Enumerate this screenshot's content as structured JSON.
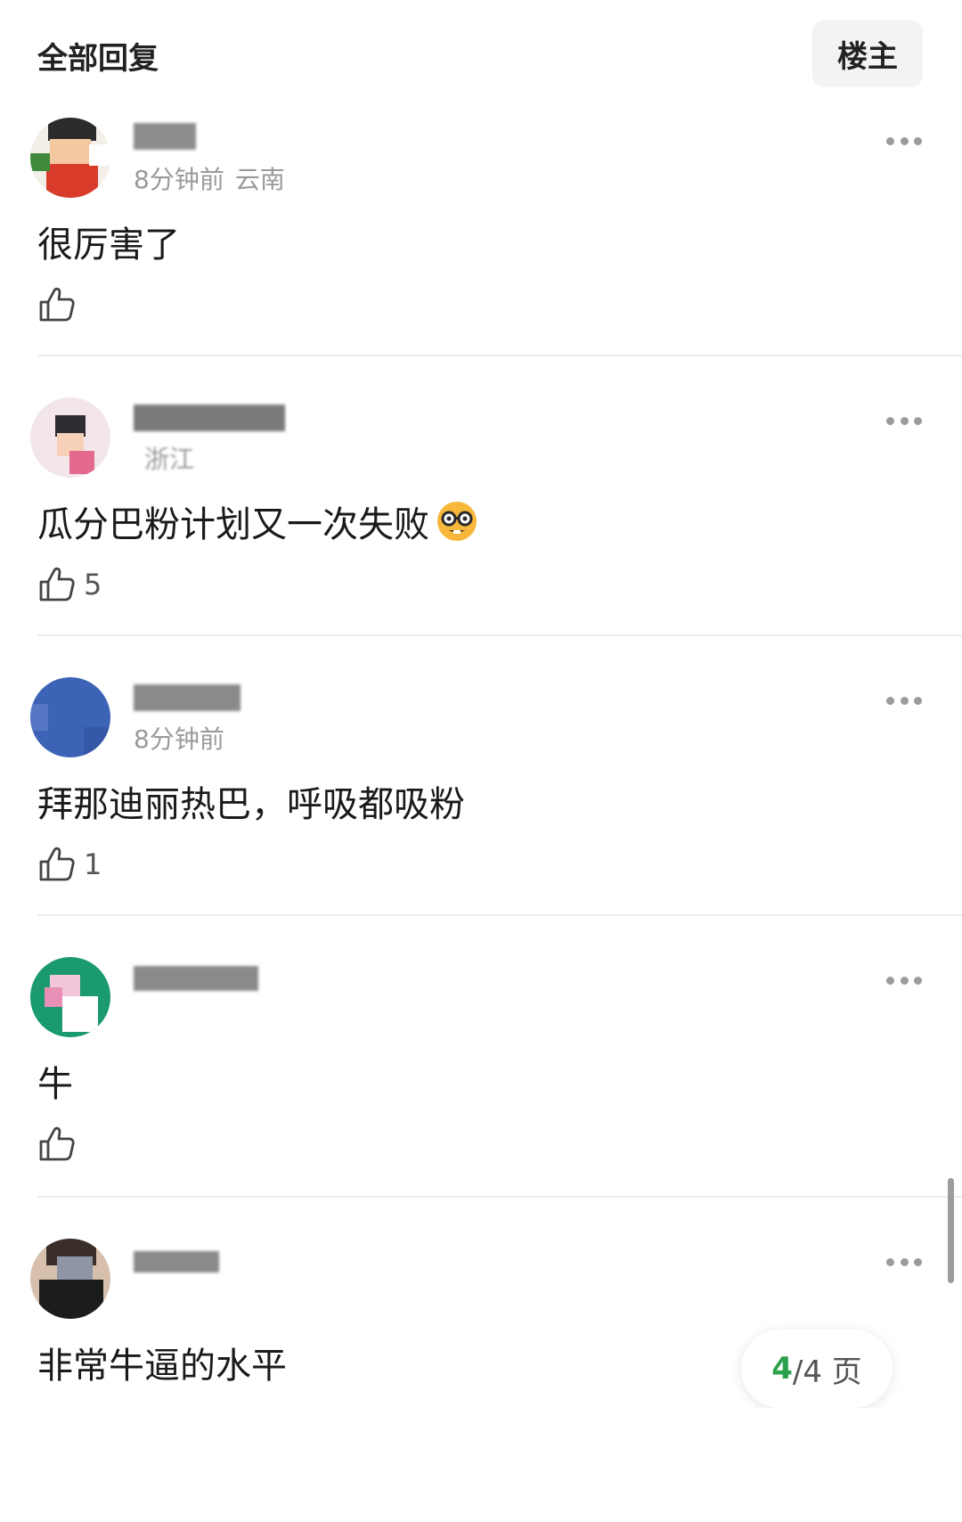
{
  "header": {
    "title": "全部回复",
    "op_button": "楼主"
  },
  "comments": [
    {
      "username": "",
      "time": "8分钟前",
      "location": "云南",
      "text": "很厉害了",
      "likes": "",
      "avatar_colors": [
        "#2b2b2b",
        "#d93b2b",
        "#f4c9a1",
        "#3f8a3a",
        "#ffffff"
      ]
    },
    {
      "username": "",
      "time": "",
      "location": "浙江",
      "text": "瓜分巴粉计划又一次失败",
      "emoji": "nerd-face-icon",
      "likes": "5",
      "avatar_colors": [
        "#f3e6ea",
        "#e36a8c",
        "#2f2b33",
        "#f7d0b8"
      ]
    },
    {
      "username": "",
      "time": "8分钟前",
      "location": "",
      "text": "拜那迪丽热巴，呼吸都吸粉",
      "likes": "1",
      "avatar_colors": [
        "#3d63b6",
        "#3458a7",
        "#5678c4"
      ]
    },
    {
      "username": "",
      "time": "",
      "location": "",
      "text": "牛",
      "likes": "",
      "avatar_colors": [
        "#1a9a6e",
        "#f3c6da",
        "#ffffff",
        "#e78fb5"
      ]
    },
    {
      "username": "",
      "time": "",
      "location": "",
      "text": "非常牛逼的水平",
      "likes": "",
      "avatar_colors": [
        "#3a2e2a",
        "#1c1c1c",
        "#d6c0ad",
        "#8e96a5"
      ]
    }
  ],
  "pagination": {
    "current": "4",
    "total": "/4 页"
  },
  "colors": {
    "accent": "#2aa14a",
    "divider": "#ececec",
    "meta": "#9a9a9a"
  }
}
